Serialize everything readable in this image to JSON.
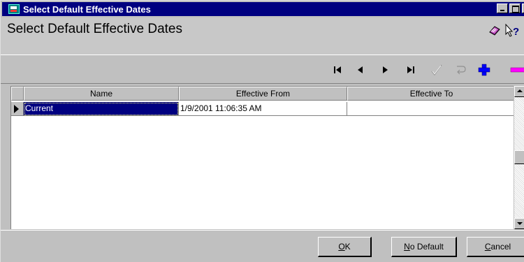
{
  "window": {
    "title": "Select Default Effective Dates",
    "controls": {
      "minimize": "minimize-icon",
      "maximize": "maximize-icon",
      "close": "close-icon"
    }
  },
  "header": {
    "title": "Select Default Effective Dates",
    "icons": [
      "book-icon",
      "whats-this-help-icon"
    ]
  },
  "toolbar": {
    "buttons": [
      {
        "name": "first-record-icon",
        "enabled": true
      },
      {
        "name": "previous-record-icon",
        "enabled": true
      },
      {
        "name": "next-record-icon",
        "enabled": true
      },
      {
        "name": "last-record-icon",
        "enabled": true
      },
      {
        "name": "post-checkmark-icon",
        "enabled": false
      },
      {
        "name": "cancel-edit-icon",
        "enabled": false
      },
      {
        "name": "insert-plus-icon",
        "enabled": true
      },
      {
        "name": "delete-minus-icon",
        "enabled": true
      }
    ]
  },
  "grid": {
    "columns": [
      "Name",
      "Effective From",
      "Effective To"
    ],
    "rows": [
      {
        "name": "Current",
        "effective_from": "1/9/2001 11:06:35 AM",
        "effective_to": ""
      }
    ]
  },
  "footer": {
    "ok": {
      "mnemonic": "O",
      "rest": "K"
    },
    "no_default": {
      "mnemonic": "N",
      "rest": "o Default"
    },
    "cancel": {
      "mnemonic": "C",
      "rest": "ancel"
    }
  },
  "colors": {
    "title_bar": "#000080",
    "face": "#c0c0c0",
    "selection": "#000080",
    "insert_icon": "#0000ff",
    "delete_icon": "#ff00ff"
  }
}
